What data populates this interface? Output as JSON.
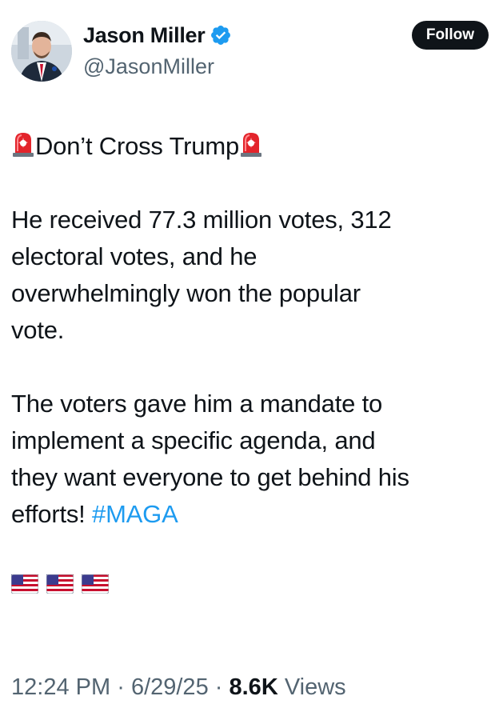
{
  "author": {
    "display_name": "Jason Miller",
    "handle": "@JasonMiller",
    "verified": true,
    "verified_icon": "verified-badge-icon",
    "verified_color": "#1d9bf0"
  },
  "follow_button": {
    "label": "Follow"
  },
  "tweet": {
    "headline": "Don’t Cross Trump",
    "headline_icon": "police-siren-emoji",
    "paragraph1_lines": [
      "He received 77.3 million votes, 312",
      "electoral votes, and he",
      "overwhelmingly won the popular",
      "vote."
    ],
    "paragraph2_lines": [
      "The voters gave him a mandate to",
      "implement a specific agenda, and",
      "they want everyone to get behind his"
    ],
    "paragraph2_last": "efforts!",
    "hashtag": "#MAGA",
    "flags": [
      "us-flag-emoji",
      "us-flag-emoji",
      "us-flag-emoji"
    ]
  },
  "meta": {
    "time": "12:24 PM",
    "date": "6/29/25",
    "separator": "·",
    "views_count": "8.6K",
    "views_label": "Views"
  },
  "colors": {
    "text": "#0f1419",
    "secondary": "#536471",
    "link": "#1d9bf0",
    "button_bg": "#0f1419"
  }
}
